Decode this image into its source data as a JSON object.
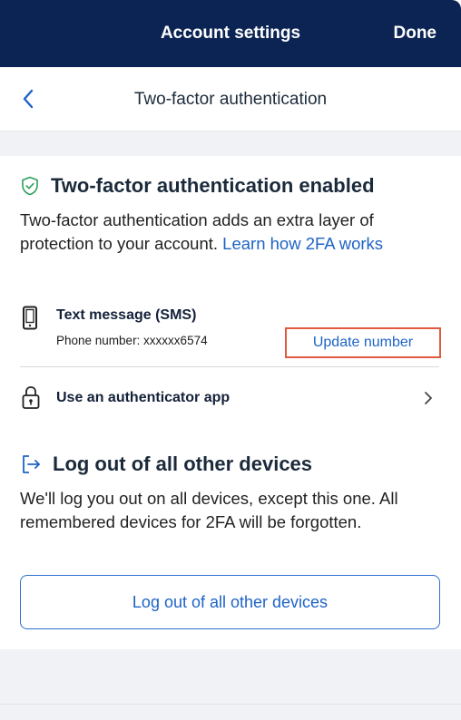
{
  "header": {
    "title": "Account settings",
    "done_label": "Done"
  },
  "subheader": {
    "title": "Two-factor authentication"
  },
  "two_factor": {
    "heading": "Two-factor authentication enabled",
    "description": "Two-factor authentication adds an extra layer of protection to your account.",
    "learn_link": "Learn how 2FA works",
    "sms": {
      "title": "Text message (SMS)",
      "phone_label": "Phone number: xxxxxx6574",
      "update_button": "Update number"
    },
    "authenticator": {
      "label": "Use an authenticator app"
    }
  },
  "logout": {
    "heading": "Log out of all other devices",
    "description": "We'll log you out on all devices, except this one. All remembered devices for 2FA will be forgotten.",
    "button_label": "Log out of all other devices"
  },
  "colors": {
    "header_bg": "#0b2454",
    "link": "#1e63c6",
    "highlight_border": "#e15a3f",
    "success_green": "#2e9f5b"
  },
  "icons": {
    "back": "chevron-left-icon",
    "shield": "shield-check-icon",
    "phone": "phone-icon",
    "lock": "lock-icon",
    "chevron": "chevron-right-icon",
    "logout": "logout-icon"
  }
}
